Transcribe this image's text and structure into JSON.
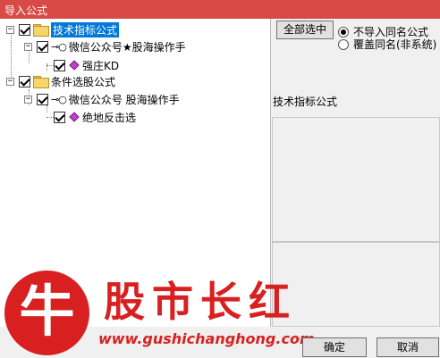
{
  "window": {
    "title": "导入公式"
  },
  "tree": {
    "root1": {
      "label": "技术指标公式"
    },
    "group1": {
      "label": "微信公众号★股海操作手"
    },
    "item1": {
      "label": "强庄KD"
    },
    "root2": {
      "label": "条件选股公式"
    },
    "group2": {
      "label": "微信公众号 股海操作手"
    },
    "item2": {
      "label": "绝地反击选"
    }
  },
  "options": {
    "select_all_label": "全部选中",
    "radio_no_import": "不导入同名公式",
    "radio_overwrite": "覆盖同名(非系统)",
    "selected": "不导入同名公式"
  },
  "details": {
    "type_label": "技术指标公式"
  },
  "footer": {
    "ok_label": "确定",
    "cancel_label": "取消"
  },
  "watermark": {
    "logo_char": "牛",
    "title": "股市长红",
    "url": "www.gushichanghong.com"
  },
  "colors": {
    "titlebar": "#d84a45",
    "watermark": "#d82020",
    "selection": "#0078d7"
  }
}
